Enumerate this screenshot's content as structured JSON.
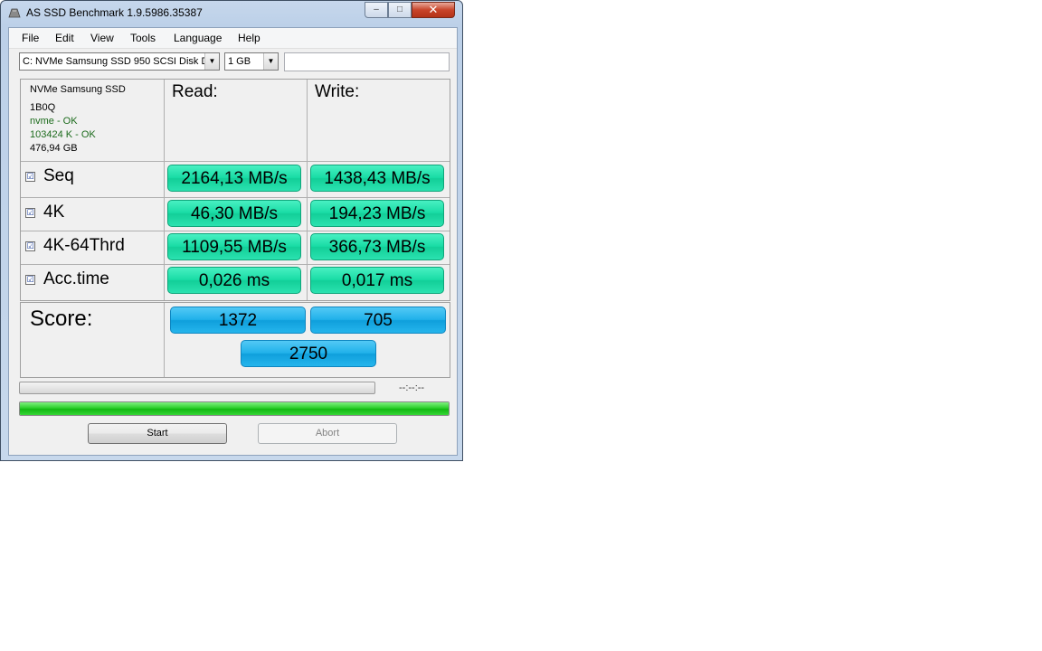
{
  "window": {
    "title": "AS SSD Benchmark 1.9.5986.35387",
    "close_label": "✕",
    "maximize_label": "□",
    "minimize_label": "–"
  },
  "menu": [
    "File",
    "Edit",
    "View",
    "Tools",
    "Language",
    "Help"
  ],
  "toolbar": {
    "drive_select": "C: NVMe Samsung SSD 950 SCSI Disk D",
    "size_select": "1 GB",
    "text_value": ""
  },
  "drive_info": {
    "model": "NVMe Samsung SSD",
    "firmware": "1B0Q",
    "driver_status": "nvme - OK",
    "alignment_status": "103424 K - OK",
    "capacity": "476,94 GB"
  },
  "columns": {
    "read": "Read:",
    "write": "Write:"
  },
  "rows": [
    {
      "label": "Seq",
      "checked": true,
      "read": "2164,13 MB/s",
      "write": "1438,43 MB/s"
    },
    {
      "label": "4K",
      "checked": true,
      "read": "46,30 MB/s",
      "write": "194,23 MB/s"
    },
    {
      "label": "4K-64Thrd",
      "checked": true,
      "read": "1109,55 MB/s",
      "write": "366,73 MB/s"
    },
    {
      "label": "Acc.time",
      "checked": true,
      "read": "0,026 ms",
      "write": "0,017 ms"
    }
  ],
  "checkmark": "☑",
  "score": {
    "label": "Score:",
    "read": "1372",
    "write": "705",
    "total": "2750"
  },
  "status": {
    "timer": "--:--:--",
    "progress_fraction": 1.0
  },
  "buttons": {
    "start": "Start",
    "abort": "Abort"
  },
  "colors": {
    "result_green": "#19dca5",
    "score_blue": "#20b1ea",
    "progress_green": "#2ccf2c"
  }
}
